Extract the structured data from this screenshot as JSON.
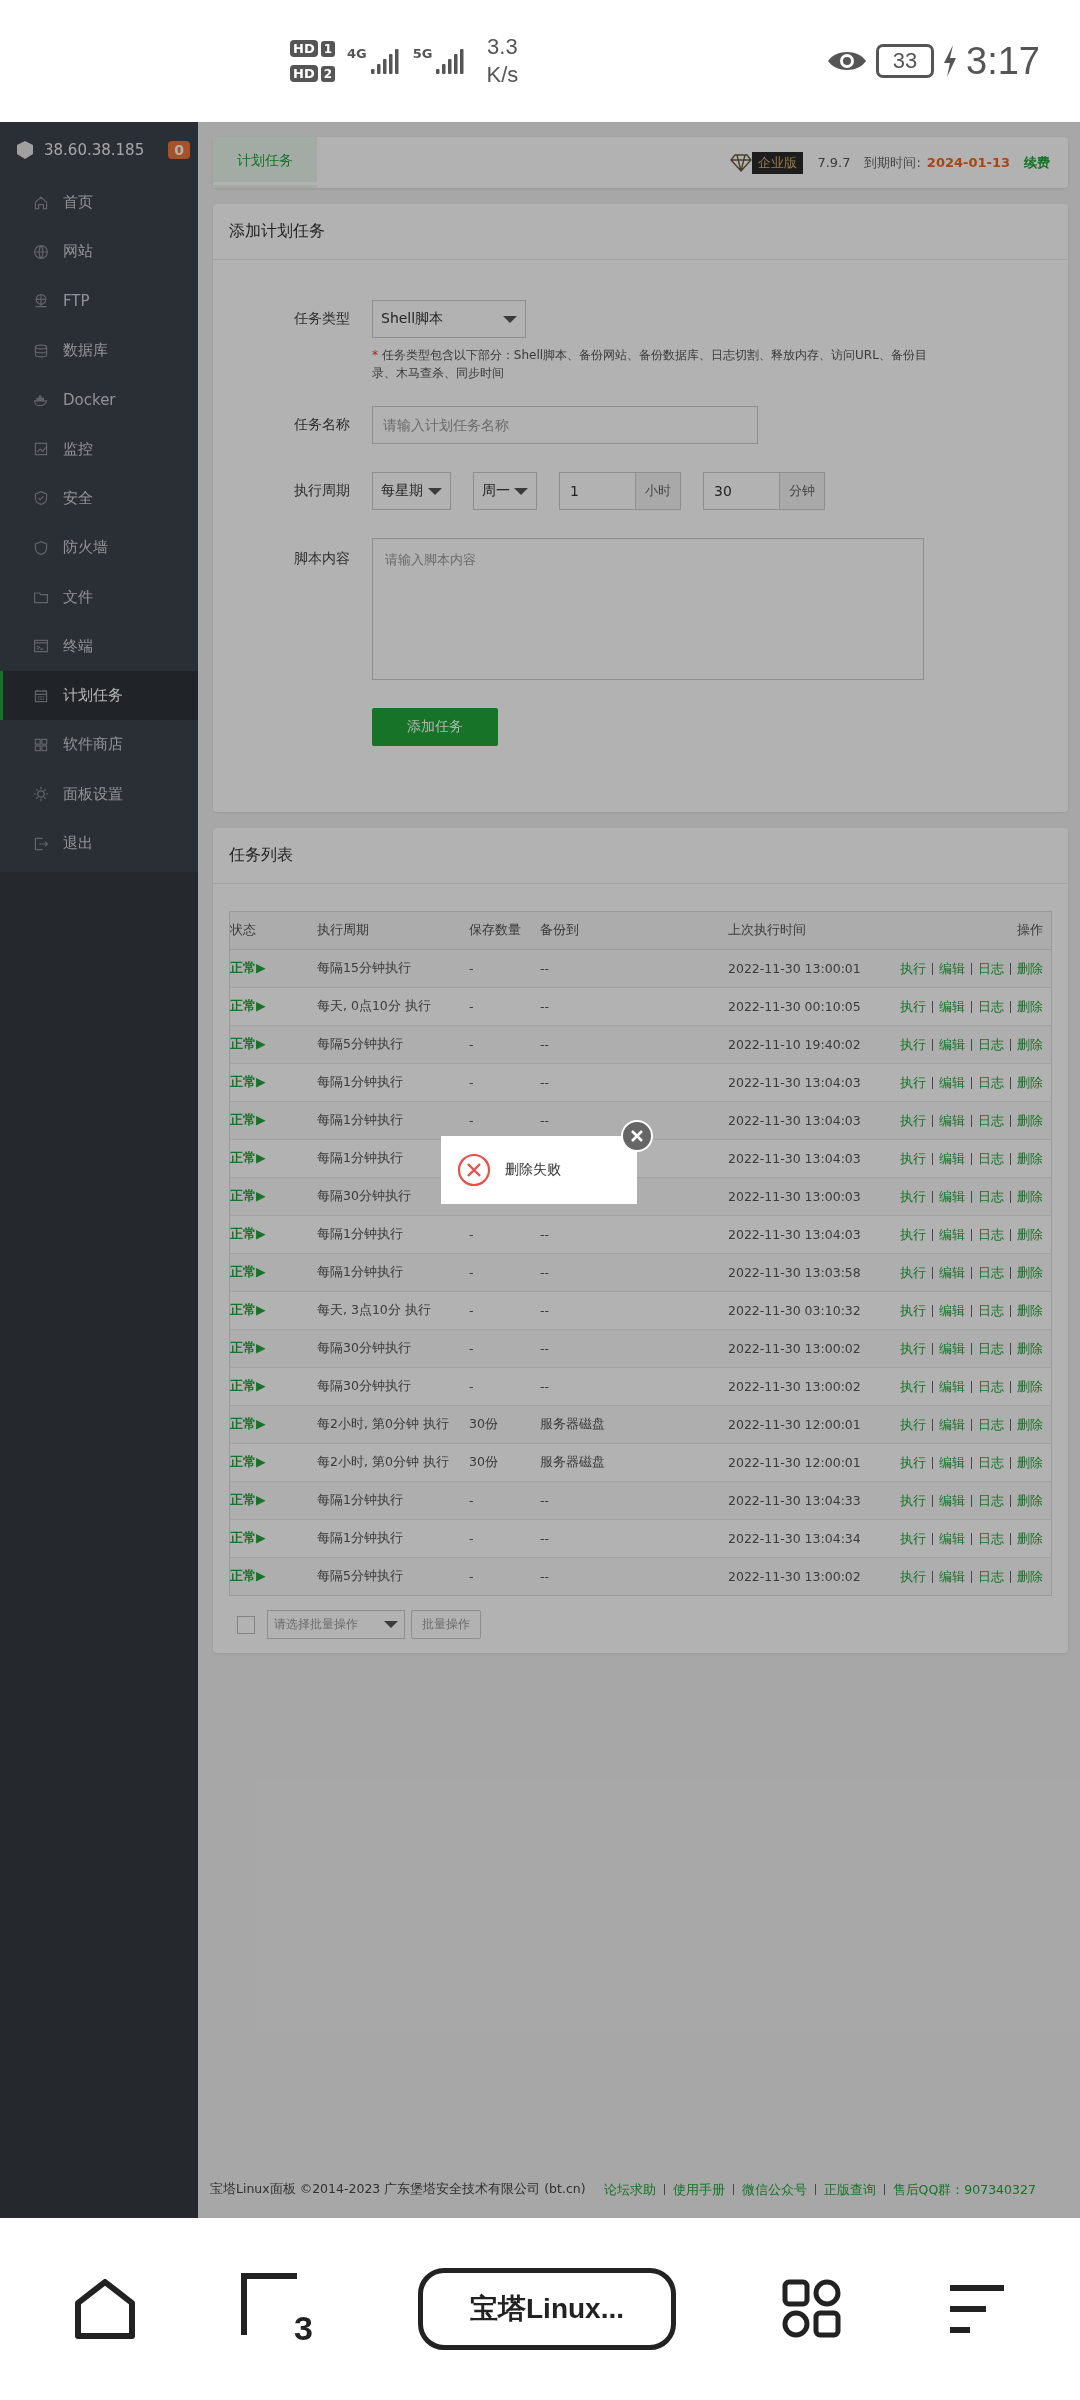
{
  "status_bar": {
    "sims": [
      {
        "label": "HD",
        "slot": "1"
      },
      {
        "label": "HD",
        "slot": "2"
      }
    ],
    "networks": [
      "4G",
      "5G"
    ],
    "speed": [
      "3.3",
      "K/s"
    ],
    "battery": "33",
    "time": "3:17"
  },
  "sidebar": {
    "host": "38.60.38.185",
    "badge": "0",
    "items": [
      {
        "label": "首页",
        "selected": false
      },
      {
        "label": "网站",
        "selected": false
      },
      {
        "label": "FTP",
        "selected": false
      },
      {
        "label": "数据库",
        "selected": false
      },
      {
        "label": "Docker",
        "selected": false
      },
      {
        "label": "监控",
        "selected": false
      },
      {
        "label": "安全",
        "selected": false
      },
      {
        "label": "防火墙",
        "selected": false
      },
      {
        "label": "文件",
        "selected": false
      },
      {
        "label": "终端",
        "selected": false
      },
      {
        "label": "计划任务",
        "selected": true
      },
      {
        "label": "软件商店",
        "selected": false
      },
      {
        "label": "面板设置",
        "selected": false
      },
      {
        "label": "退出",
        "selected": false
      }
    ]
  },
  "top_bar": {
    "tabs": [
      {
        "label": "计划任务",
        "selected": true
      }
    ],
    "edition": "企业版",
    "version": "7.9.7",
    "expiry_label": "到期时间:",
    "expiry_date": "2024-01-13",
    "renew": "续费"
  },
  "add_form": {
    "title": "添加计划任务",
    "task_type": {
      "label": "任务类型",
      "value": "Shell脚本"
    },
    "hint": {
      "mark": "*",
      "text": "任务类型包含以下部分：Shell脚本、备份网站、备份数据库、日志切割、释放内存、访问URL、备份目录、木马查杀、同步时间"
    },
    "task_name": {
      "label": "任务名称",
      "placeholder": "请输入计划任务名称"
    },
    "cycle": {
      "label": "执行周期",
      "period": "每星期",
      "weekday": "周一",
      "hour": "1",
      "hour_unit": "小时",
      "minute": "30",
      "minute_unit": "分钟"
    },
    "script": {
      "label": "脚本内容",
      "placeholder": "请输入脚本内容"
    },
    "submit": "添加任务"
  },
  "task_list": {
    "title": "任务列表",
    "columns": [
      "状态",
      "执行周期",
      "保存数量",
      "备份到",
      "上次执行时间",
      "操作"
    ],
    "rows": [
      {
        "status": "正常▶",
        "cycle": "每隔15分钟执行",
        "count": "-",
        "backup_to": "--",
        "last_run": "2022-11-30 13:00:01",
        "actions": [
          "执行",
          "编辑",
          "日志",
          "删除"
        ]
      },
      {
        "status": "正常▶",
        "cycle": "每天, 0点10分 执行",
        "count": "-",
        "backup_to": "--",
        "last_run": "2022-11-30 00:10:05",
        "actions": [
          "执行",
          "编辑",
          "日志",
          "删除"
        ]
      },
      {
        "status": "正常▶",
        "cycle": "每隔5分钟执行",
        "count": "-",
        "backup_to": "--",
        "last_run": "2022-11-10 19:40:02",
        "actions": [
          "执行",
          "编辑",
          "日志",
          "删除"
        ]
      },
      {
        "status": "正常▶",
        "cycle": "每隔1分钟执行",
        "count": "-",
        "backup_to": "--",
        "last_run": "2022-11-30 13:04:03",
        "actions": [
          "执行",
          "编辑",
          "日志",
          "删除"
        ]
      },
      {
        "status": "正常▶",
        "cycle": "每隔1分钟执行",
        "count": "-",
        "backup_to": "--",
        "last_run": "2022-11-30 13:04:03",
        "actions": [
          "执行",
          "编辑",
          "日志",
          "删除"
        ]
      },
      {
        "status": "正常▶",
        "cycle": "每隔1分钟执行",
        "last_run": "2022-11-30 13:04:03",
        "actions": [
          "执行",
          "编辑",
          "日志",
          "删除"
        ]
      },
      {
        "status": "正常▶",
        "cycle": "每隔30分钟执行",
        "last_run": "2022-11-30 13:00:03",
        "actions": [
          "执行",
          "编辑",
          "日志",
          "删除"
        ]
      },
      {
        "status": "正常▶",
        "cycle": "每隔1分钟执行",
        "count": "-",
        "backup_to": "--",
        "last_run": "2022-11-30 13:04:03",
        "actions": [
          "执行",
          "编辑",
          "日志",
          "删除"
        ]
      },
      {
        "status": "正常▶",
        "cycle": "每隔1分钟执行",
        "count": "-",
        "backup_to": "--",
        "last_run": "2022-11-30 13:03:58",
        "actions": [
          "执行",
          "编辑",
          "日志",
          "删除"
        ]
      },
      {
        "status": "正常▶",
        "cycle": "每天, 3点10分 执行",
        "count": "-",
        "backup_to": "--",
        "last_run": "2022-11-30 03:10:32",
        "actions": [
          "执行",
          "编辑",
          "日志",
          "删除"
        ]
      },
      {
        "status": "正常▶",
        "cycle": "每隔30分钟执行",
        "count": "-",
        "backup_to": "--",
        "last_run": "2022-11-30 13:00:02",
        "actions": [
          "执行",
          "编辑",
          "日志",
          "删除"
        ]
      },
      {
        "status": "正常▶",
        "cycle": "每隔30分钟执行",
        "count": "-",
        "backup_to": "--",
        "last_run": "2022-11-30 13:00:02",
        "actions": [
          "执行",
          "编辑",
          "日志",
          "删除"
        ]
      },
      {
        "status": "正常▶",
        "cycle": "每2小时, 第0分钟 执行",
        "count": "30份",
        "backup_to": "服务器磁盘",
        "last_run": "2022-11-30 12:00:01",
        "actions": [
          "执行",
          "编辑",
          "日志",
          "删除"
        ]
      },
      {
        "status": "正常▶",
        "cycle": "每2小时, 第0分钟 执行",
        "count": "30份",
        "backup_to": "服务器磁盘",
        "last_run": "2022-11-30 12:00:01",
        "actions": [
          "执行",
          "编辑",
          "日志",
          "删除"
        ]
      },
      {
        "status": "正常▶",
        "cycle": "每隔1分钟执行",
        "count": "-",
        "backup_to": "--",
        "last_run": "2022-11-30 13:04:33",
        "actions": [
          "执行",
          "编辑",
          "日志",
          "删除"
        ]
      },
      {
        "status": "正常▶",
        "cycle": "每隔1分钟执行",
        "count": "-",
        "backup_to": "--",
        "last_run": "2022-11-30 13:04:34",
        "actions": [
          "执行",
          "编辑",
          "日志",
          "删除"
        ]
      },
      {
        "status": "正常▶",
        "cycle": "每隔5分钟执行",
        "count": "-",
        "backup_to": "--",
        "last_run": "2022-11-30 13:00:02",
        "actions": [
          "执行",
          "编辑",
          "日志",
          "删除"
        ]
      }
    ],
    "batch": {
      "checked": false,
      "placeholder": "请选择批量操作",
      "button": "批量操作"
    }
  },
  "footer": {
    "copyright": "宝塔Linux面板 ©2014-2023 广东堡塔安全技术有限公司 (bt.cn)",
    "links": [
      "论坛求助",
      "使用手册",
      "微信公众号",
      "正版查询",
      "售后QQ群：907340327"
    ]
  },
  "toast": {
    "kind": "error",
    "text": "删除失败"
  },
  "nav_bar": {
    "recent_count": "3",
    "app_label": "宝塔Linux..."
  }
}
